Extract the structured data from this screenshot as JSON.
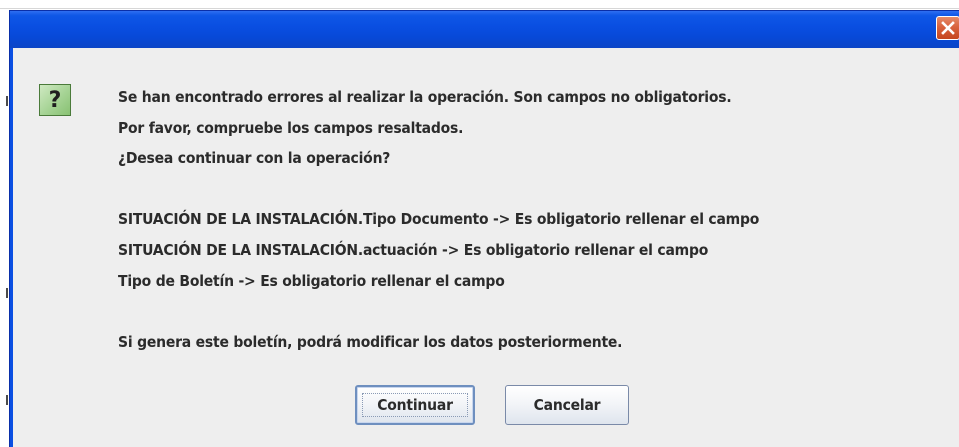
{
  "dialog": {
    "title": "",
    "icon": "question-icon",
    "icon_glyph": "?",
    "message_lines": [
      "Se han encontrado errores al realizar la operación. Son campos no obligatorios.",
      "Por favor, compruebe los campos resaltados.",
      "¿Desea continuar con la operación?",
      "",
      "SITUACIÓN DE LA INSTALACIÓN.Tipo Documento  ->  Es obligatorio rellenar el campo",
      "SITUACIÓN DE LA INSTALACIÓN.actuación  ->  Es obligatorio rellenar el campo",
      "Tipo de Boletín  ->  Es obligatorio rellenar el campo",
      "",
      "Si genera este boletín, podrá modificar los datos posteriormente."
    ],
    "buttons": {
      "continue_label": "Continuar",
      "cancel_label": "Cancelar"
    }
  },
  "colors": {
    "titlebar": "#0a4fe2",
    "close_button": "#d9623e",
    "dialog_background": "#eeeeee",
    "icon_green": "#a5d394"
  }
}
